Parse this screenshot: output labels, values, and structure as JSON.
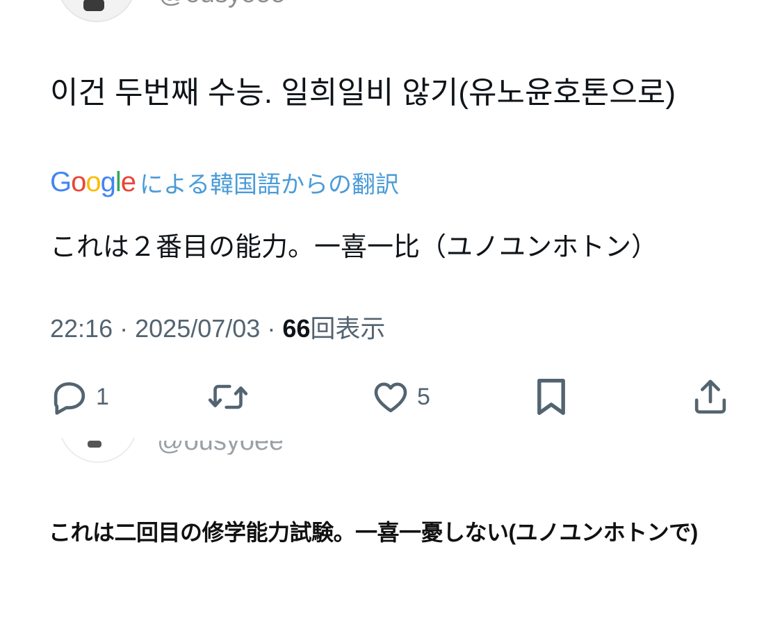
{
  "tweet": {
    "handle": "@ousyoee",
    "text": "이건 두번째 수능. 일희일비 않기(유노윤호톤으로)",
    "translation": {
      "provider_logo_letters": [
        "G",
        "o",
        "o",
        "g",
        "l",
        "e"
      ],
      "label": "による韓国語からの翻訳",
      "text": "これは２番目の能力。一喜一比（ユノユンホトン）"
    },
    "meta": {
      "time": "22:16",
      "separator": "·",
      "date": "2025/07/03",
      "views_count": "66",
      "views_label": "回表示"
    },
    "actions": {
      "reply_count": "1",
      "retweet_count": "",
      "like_count": "5"
    }
  },
  "second_tweet": {
    "handle": "@ousyoee"
  },
  "caption": {
    "text": "これは二回目の修学能力試験。一喜一憂しない(ユノユンホトンで)"
  },
  "colors": {
    "text_primary": "#0f1419",
    "text_secondary": "#536471",
    "translation_link": "#4a9bd8",
    "google_blue": "#4285f4",
    "google_red": "#ea4335",
    "google_yellow": "#fbbc05",
    "google_green": "#34a853"
  },
  "icons": {
    "reply": "reply-icon",
    "retweet": "retweet-icon",
    "like": "heart-icon",
    "bookmark": "bookmark-icon",
    "share": "share-icon"
  }
}
